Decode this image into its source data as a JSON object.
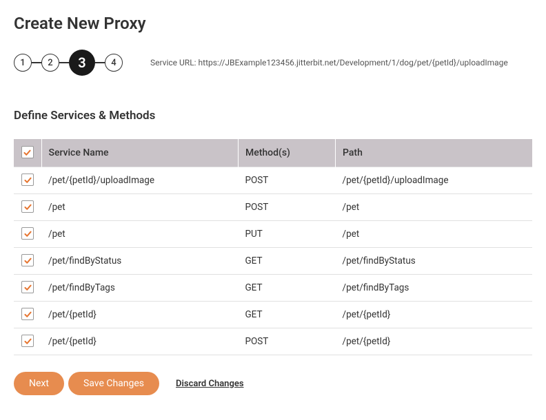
{
  "title": "Create New Proxy",
  "stepper": {
    "steps": [
      "1",
      "2",
      "3",
      "4"
    ],
    "activeIndex": 2
  },
  "service_url_label": "Service URL: https://JBExample123456.jitterbit.net/Development/1/dog/pet/{petId}/uploadImage",
  "section_title": "Define Services & Methods",
  "table": {
    "headers": {
      "service_name": "Service Name",
      "methods": "Method(s)",
      "path": "Path"
    },
    "rows": [
      {
        "checked": true,
        "service_name": "/pet/{petId}/uploadImage",
        "method": "POST",
        "path": "/pet/{petId}/uploadImage"
      },
      {
        "checked": true,
        "service_name": "/pet",
        "method": "POST",
        "path": "/pet"
      },
      {
        "checked": true,
        "service_name": "/pet",
        "method": "PUT",
        "path": "/pet"
      },
      {
        "checked": true,
        "service_name": "/pet/findByStatus",
        "method": "GET",
        "path": "/pet/findByStatus"
      },
      {
        "checked": true,
        "service_name": "/pet/findByTags",
        "method": "GET",
        "path": "/pet/findByTags"
      },
      {
        "checked": true,
        "service_name": "/pet/{petId}",
        "method": "GET",
        "path": "/pet/{petId}"
      },
      {
        "checked": true,
        "service_name": "/pet/{petId}",
        "method": "POST",
        "path": "/pet/{petId}"
      }
    ]
  },
  "buttons": {
    "next": "Next",
    "save": "Save Changes",
    "discard": "Discard Changes"
  }
}
